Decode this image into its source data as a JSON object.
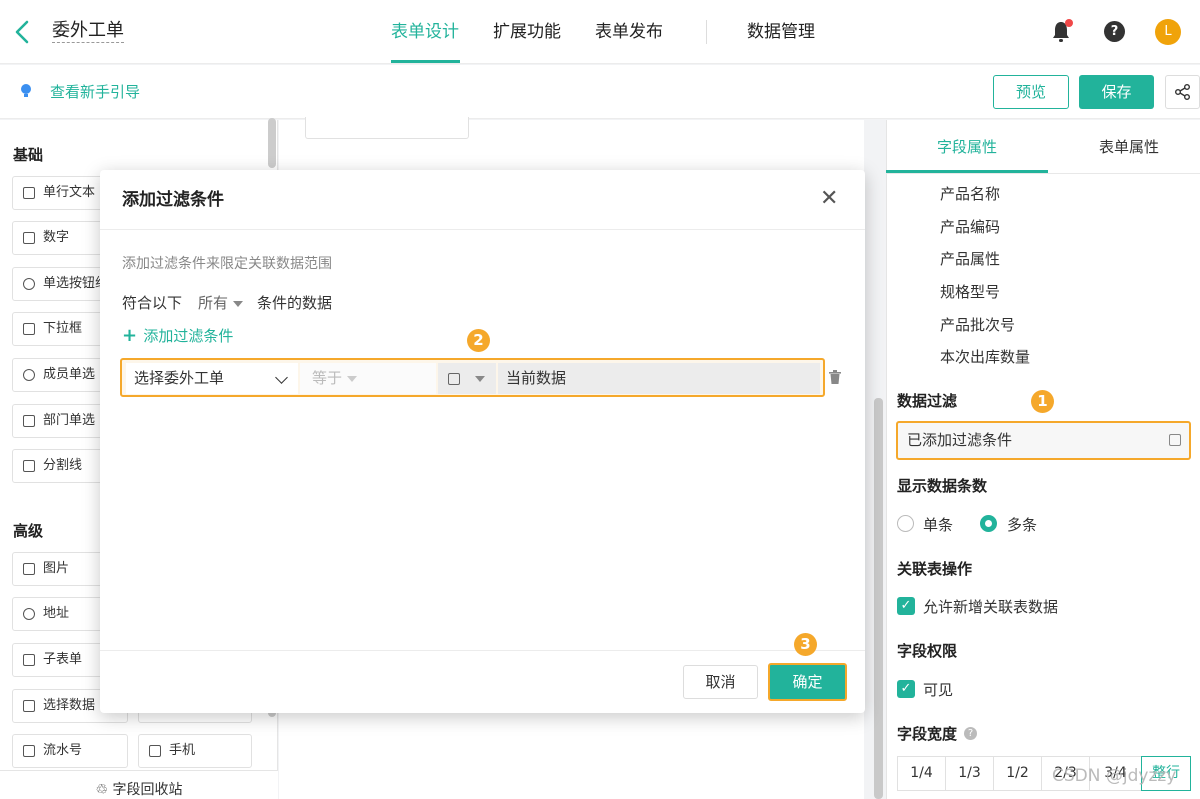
{
  "header": {
    "app_title": "委外工单",
    "tabs": [
      "表单设计",
      "扩展功能",
      "表单发布",
      "数据管理"
    ],
    "active_tab": "表单设计",
    "avatar_letter": "L"
  },
  "subbar": {
    "guide": "查看新手引导",
    "preview": "预览",
    "save": "保存"
  },
  "left_panel": {
    "basic_title": "基础",
    "basic_items": [
      "单行文本",
      "数字",
      "单选按钮组",
      "下拉框",
      "成员单选",
      "部门单选",
      "分割线"
    ],
    "advanced_title": "高级",
    "advanced_items": [
      "图片",
      "地址",
      "子表单",
      "选择数据",
      "流水号",
      "手机"
    ],
    "recycle": "字段回收站"
  },
  "right_panel": {
    "tabs": [
      "字段属性",
      "表单属性"
    ],
    "fields": [
      "产品名称",
      "产品编码",
      "产品属性",
      "规格型号",
      "产品批次号",
      "本次出库数量"
    ],
    "filter_title": "数据过滤",
    "filter_value": "已添加过滤条件",
    "display_count_title": "显示数据条数",
    "radio_single": "单条",
    "radio_multi": "多条",
    "assoc_title": "关联表操作",
    "assoc_check": "允许新增关联表数据",
    "perm_title": "字段权限",
    "perm_check": "可见",
    "width_title": "字段宽度",
    "width_options": [
      "1/4",
      "1/3",
      "1/2",
      "2/3",
      "3/4",
      "整行"
    ]
  },
  "modal": {
    "title": "添加过滤条件",
    "desc": "添加过滤条件来限定关联数据范围",
    "rule_prefix": "符合以下",
    "rule_select": "所有",
    "rule_suffix": "条件的数据",
    "add_link": "添加过滤条件",
    "cond_field": "选择委外工单",
    "cond_op": "等于",
    "cond_value": "当前数据",
    "cancel": "取消",
    "ok": "确定"
  },
  "annotations": {
    "n1": "1",
    "n2": "2",
    "n3": "3"
  },
  "watermark": "CSDN @jdyzzy",
  "colors": {
    "accent": "#22b39b",
    "highlight": "#f5a82b"
  }
}
